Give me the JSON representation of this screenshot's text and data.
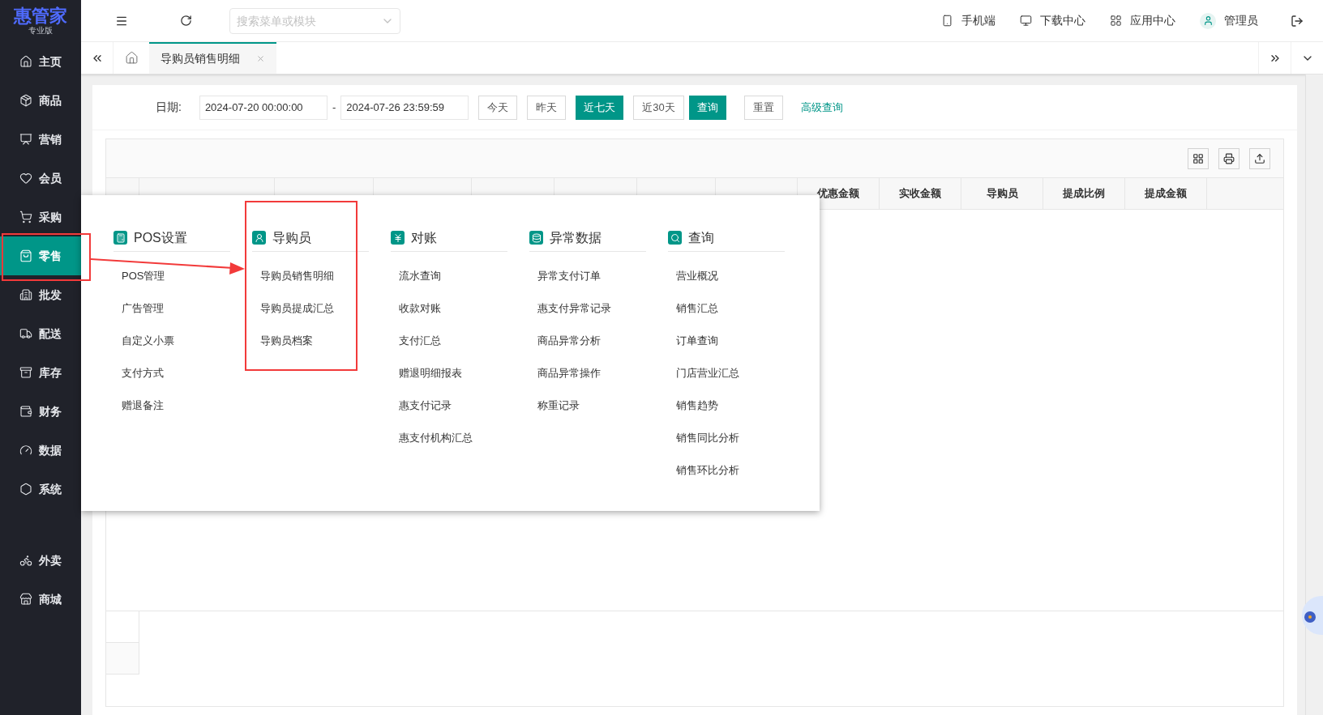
{
  "brand": {
    "name": "惠管家",
    "edition": "专业版"
  },
  "sidebar": {
    "items": [
      {
        "label": "主页",
        "selected": false
      },
      {
        "label": "商品",
        "selected": false
      },
      {
        "label": "营销",
        "selected": false
      },
      {
        "label": "会员",
        "selected": false
      },
      {
        "label": "采购",
        "selected": false
      },
      {
        "label": "零售",
        "selected": true
      },
      {
        "label": "批发",
        "selected": false
      },
      {
        "label": "配送",
        "selected": false
      },
      {
        "label": "库存",
        "selected": false
      },
      {
        "label": "财务",
        "selected": false
      },
      {
        "label": "数据",
        "selected": false
      },
      {
        "label": "系统",
        "selected": false
      }
    ],
    "extra_items": [
      {
        "label": "外卖",
        "selected": false
      },
      {
        "label": "商城",
        "selected": false
      }
    ]
  },
  "topbar": {
    "search": {
      "placeholder": "搜索菜单或模块"
    },
    "links": [
      "手机端",
      "下载中心",
      "应用中心",
      "管理员"
    ]
  },
  "tabs": [
    {
      "label": "导购员销售明细",
      "selected": true
    }
  ],
  "filter": {
    "date_label": "日期:",
    "start": "2024-07-20 00:00:00",
    "separator": "-",
    "end": "2024-07-26 23:59:59",
    "quick_ranges": [
      {
        "label": "今天",
        "selected": false
      },
      {
        "label": "昨天",
        "selected": false
      },
      {
        "label": "近七天",
        "selected": true
      },
      {
        "label": "近30天",
        "selected": false
      }
    ],
    "query": "查询",
    "reset": "重置",
    "advanced": "高级查询"
  },
  "table": {
    "columns": [
      "优惠金额",
      "实收金额",
      "导购员",
      "提成比例",
      "提成金额"
    ]
  },
  "menu": {
    "columns": [
      {
        "title": "POS设置",
        "items": [
          "POS管理",
          "广告管理",
          "自定义小票",
          "支付方式",
          "赠退备注"
        ]
      },
      {
        "title": "导购员",
        "items": [
          "导购员销售明细",
          "导购员提成汇总",
          "导购员档案"
        ]
      },
      {
        "title": "对账",
        "items": [
          "流水查询",
          "收款对账",
          "支付汇总",
          "赠退明细报表",
          "惠支付记录",
          "惠支付机构汇总"
        ]
      },
      {
        "title": "异常数据",
        "items": [
          "异常支付订单",
          "惠支付异常记录",
          "商品异常分析",
          "商品异常操作",
          "称重记录"
        ]
      },
      {
        "title": "查询",
        "items": [
          "营业概况",
          "销售汇总",
          "订单查询",
          "门店营业汇总",
          "销售趋势",
          "销售同比分析",
          "销售环比分析"
        ]
      }
    ]
  }
}
